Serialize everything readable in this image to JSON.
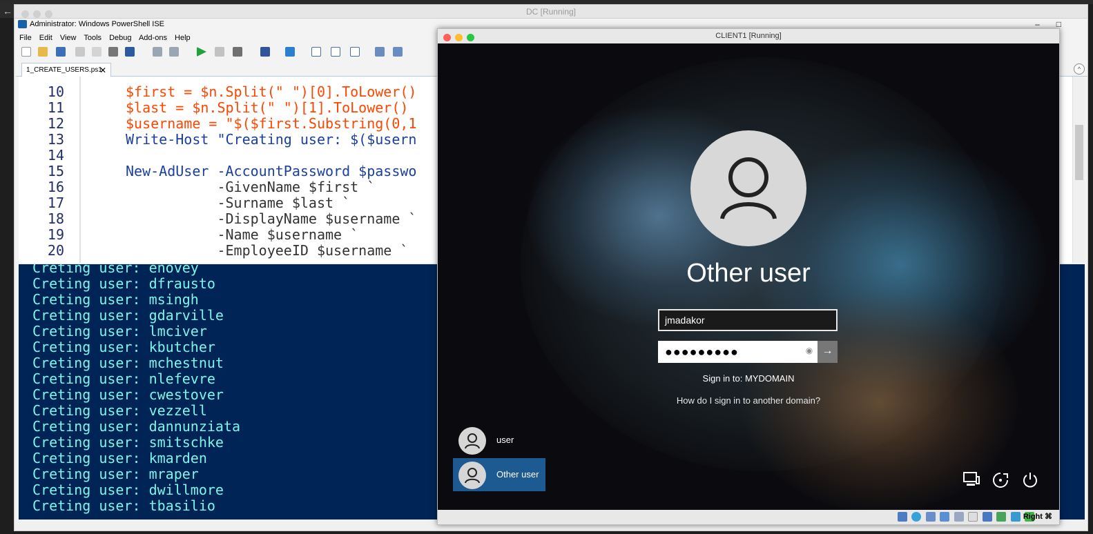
{
  "outer_window": {
    "title": "DC [Running]"
  },
  "ise": {
    "title": "Administrator: Windows PowerShell ISE",
    "window_controls": [
      "–",
      "□",
      "✕"
    ],
    "menu": [
      "File",
      "Edit",
      "View",
      "Tools",
      "Debug",
      "Add-ons",
      "Help"
    ],
    "tab": {
      "label": "1_CREATE_USERS.ps1",
      "close": "✕"
    },
    "collapse": "^",
    "editor_lines": [
      {
        "num": "10",
        "code": "$first = $n.Split(\" \")[0].ToLower()"
      },
      {
        "num": "11",
        "code": "$last = $n.Split(\" \")[1].ToLower()"
      },
      {
        "num": "12",
        "code": "$username = \"$($first.Substring(0,1"
      },
      {
        "num": "13",
        "code": "Write-Host \"Creating user: $($usern"
      },
      {
        "num": "14",
        "code": ""
      },
      {
        "num": "15",
        "code": "New-AdUser -AccountPassword $passwo"
      },
      {
        "num": "16",
        "code": "           -GivenName $first `"
      },
      {
        "num": "17",
        "code": "           -Surname $last `"
      },
      {
        "num": "18",
        "code": "           -DisplayName $username `"
      },
      {
        "num": "19",
        "code": "           -Name $username `"
      },
      {
        "num": "20",
        "code": "           -EmployeeID $username `"
      }
    ],
    "console_lines": [
      "Creting user: enovey",
      "Creting user: dfrausto",
      "Creting user: msingh",
      "Creting user: gdarville",
      "Creting user: lmciver",
      "Creting user: kbutcher",
      "Creting user: mchestnut",
      "Creting user: nlefevre",
      "Creting user: cwestover",
      "Creting user: vezzell",
      "Creting user: dannunziata",
      "Creting user: smitschke",
      "Creting user: kmarden",
      "Creting user: mraper",
      "Creting user: dwillmore",
      "Creting user: tbasilio"
    ]
  },
  "vm": {
    "title": "CLIENT1 [Running]",
    "login": {
      "heading": "Other user",
      "username_value": "jmadakor",
      "password_mask": "●●●●●●●●●",
      "reveal_icon": "eye-icon",
      "submit_arrow": "→",
      "sign_in_to": "Sign in to: MYDOMAIN",
      "other_domain_link": "How do I sign in to another domain?"
    },
    "user_tiles": [
      {
        "name": "user",
        "selected": false
      },
      {
        "name": "Other user",
        "selected": true
      }
    ],
    "system_icons": [
      "network-icon",
      "ease-of-access-icon",
      "power-icon"
    ],
    "host_key": "Right ⌘"
  },
  "colors": {
    "console_bg": "#012456",
    "console_text": "#7ff5e8",
    "keyword": "#1a3fa0",
    "variable": "#ff4500",
    "selected_tile": "#1e5a92"
  }
}
